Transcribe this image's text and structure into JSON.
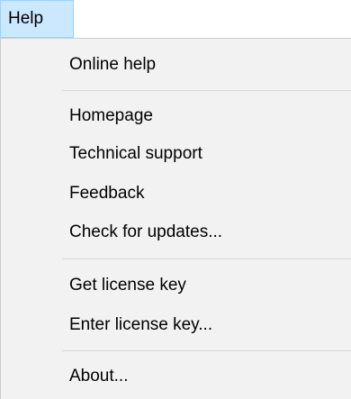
{
  "menu": {
    "title": "Help",
    "items": [
      {
        "label": "Online help"
      },
      {
        "label": "Homepage"
      },
      {
        "label": "Technical support"
      },
      {
        "label": "Feedback"
      },
      {
        "label": "Check for updates..."
      },
      {
        "label": "Get license key"
      },
      {
        "label": "Enter license key..."
      },
      {
        "label": "About..."
      }
    ]
  },
  "colors": {
    "highlight": "#cce8ff",
    "menu_background": "#f2f2f2",
    "separator": "#d7d7d7"
  }
}
